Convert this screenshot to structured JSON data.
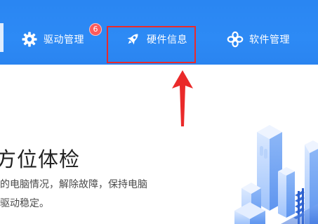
{
  "nav": {
    "items": [
      {
        "id": "driver",
        "label": "驱动管理",
        "icon": "gear-icon",
        "badge": "6"
      },
      {
        "id": "hardware",
        "label": "硬件信息",
        "icon": "rocket-icon",
        "highlighted": true
      },
      {
        "id": "software",
        "label": "软件管理",
        "icon": "flower-icon"
      }
    ]
  },
  "hero": {
    "title": "方位体检",
    "desc_line1": "的电脑情况，解除故障，保持电脑",
    "desc_line2": "驱动稳定。"
  },
  "colors": {
    "topbar": "#2a86f2",
    "badge": "#ff5a5a",
    "highlight": "#ea2a2a",
    "arrow": "#ea2a2a",
    "text_primary": "#222222",
    "text_secondary": "#4a4a4a"
  }
}
